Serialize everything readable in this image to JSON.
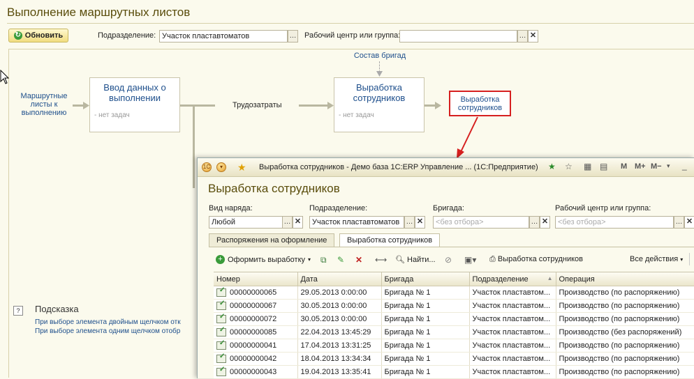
{
  "page": {
    "title": "Выполнение маршрутных листов",
    "refresh_label": "Обновить",
    "subdivision_label": "Подразделение:",
    "subdivision_value": "Участок пластавтоматов",
    "workcenter_label": "Рабочий центр или группа:",
    "workcenter_value": ""
  },
  "flow": {
    "left_link": "Маршрутные листы к выполнению",
    "box1_title": "Ввод данных о выполнении",
    "box1_sub": "- нет задач",
    "mid_label": "Трудозатраты",
    "top_link": "Состав бригад",
    "box2_title": "Выработка сотрудников",
    "box2_sub": "- нет задач",
    "highlight_link": "Выработка сотрудников"
  },
  "hint": {
    "icon": "?",
    "title": "Подсказка",
    "line1": "При выборе элемента двойным щелчком отк",
    "line2": "При выборе элемента одним щелчком отобр"
  },
  "window": {
    "title": "Выработка сотрудников - Демо база 1С:ERP Управление ... (1С:Предприятие)",
    "heading": "Выработка сотрудников",
    "filters": {
      "order_type_label": "Вид наряда:",
      "order_type_value": "Любой",
      "subdivision_label": "Подразделение:",
      "subdivision_value": "Участок пластавтоматов",
      "brigade_label": "Бригада:",
      "brigade_placeholder": "<без отбора>",
      "workcenter_label": "Рабочий центр или группа:",
      "workcenter_placeholder": "<без отбора>"
    },
    "tabs": [
      "Распоряжения на оформление",
      "Выработка сотрудников"
    ],
    "toolbar": {
      "create_label": "Оформить выработку",
      "find_label": "Найти...",
      "print_label": "Выработка сотрудников",
      "all_actions": "Все действия"
    },
    "table": {
      "columns": [
        "Номер",
        "Дата",
        "Бригада",
        "Подразделение",
        "Операция"
      ],
      "rows": [
        [
          "00000000065",
          "29.05.2013 0:00:00",
          "Бригада № 1",
          "Участок пластавтом...",
          "Производство (по распоряжению)"
        ],
        [
          "00000000067",
          "30.05.2013 0:00:00",
          "Бригада № 1",
          "Участок пластавтом...",
          "Производство (по распоряжению)"
        ],
        [
          "00000000072",
          "30.05.2013 0:00:00",
          "Бригада № 1",
          "Участок пластавтом...",
          "Производство (по распоряжению)"
        ],
        [
          "00000000085",
          "22.04.2013 13:45:29",
          "Бригада № 1",
          "Участок пластавтом...",
          "Производство (без распоряжений)"
        ],
        [
          "00000000041",
          "17.04.2013 13:31:25",
          "Бригада № 1",
          "Участок пластавтом...",
          "Производство (по распоряжению)"
        ],
        [
          "00000000042",
          "18.04.2013 13:34:34",
          "Бригада № 1",
          "Участок пластавтом...",
          "Производство (по распоряжению)"
        ],
        [
          "00000000043",
          "19.04.2013 13:35:41",
          "Бригада № 1",
          "Участок пластавтом...",
          "Производство (по распоряжению)"
        ]
      ]
    }
  }
}
